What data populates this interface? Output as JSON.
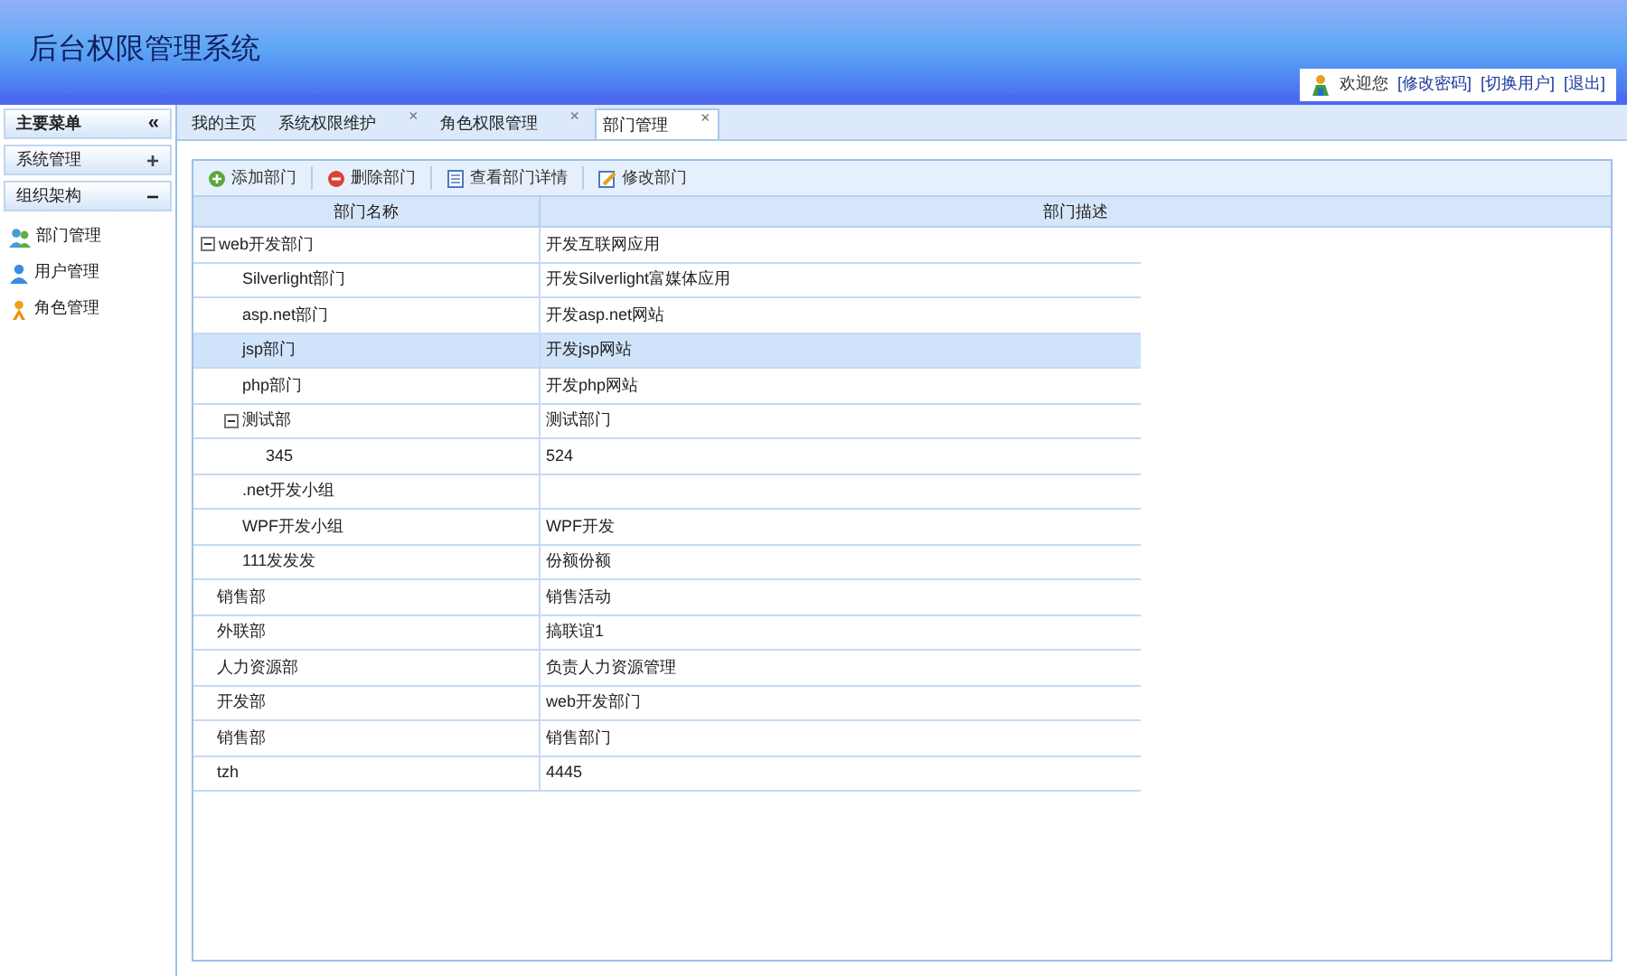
{
  "header": {
    "title": "后台权限管理系统",
    "welcome": "欢迎您",
    "links": [
      "[修改密码]",
      "[切换用户]",
      "[退出]"
    ]
  },
  "sidebar": {
    "title": "主要菜单",
    "collapse_glyph": "«",
    "sections": [
      {
        "label": "系统管理",
        "expanded": false,
        "toggle": "+"
      },
      {
        "label": "组织架构",
        "expanded": true,
        "toggle": "−"
      }
    ],
    "items": [
      {
        "label": "部门管理",
        "kind": "dept"
      },
      {
        "label": "用户管理",
        "kind": "user"
      },
      {
        "label": "角色管理",
        "kind": "role"
      }
    ]
  },
  "tabs": [
    {
      "label": "我的主页",
      "selected": false,
      "closable": false
    },
    {
      "label": "系统权限维护",
      "selected": false,
      "closable": true
    },
    {
      "label": "角色权限管理",
      "selected": false,
      "closable": true
    },
    {
      "label": "部门管理",
      "selected": true,
      "closable": true
    }
  ],
  "close_glyph": "×",
  "toolbar": [
    {
      "label": "添加部门",
      "kind": "add"
    },
    {
      "label": "删除部门",
      "kind": "delete"
    },
    {
      "label": "查看部门详情",
      "kind": "view"
    },
    {
      "label": "修改部门",
      "kind": "edit"
    }
  ],
  "table": {
    "columns": [
      "部门名称",
      "部门描述"
    ],
    "rows": [
      {
        "name": "web开发部门",
        "description": "开发互联网应用",
        "selected": false,
        "expanded": true,
        "children": [
          {
            "name": "Silverlight部门",
            "description": "开发Silverlight富媒体应用",
            "selected": false
          },
          {
            "name": "asp.net部门",
            "description": "开发asp.net网站",
            "selected": false
          },
          {
            "name": "jsp部门",
            "description": "开发jsp网站",
            "selected": true
          },
          {
            "name": "php部门",
            "description": "开发php网站",
            "selected": false
          },
          {
            "name": "测试部",
            "description": "测试部门",
            "selected": false,
            "expanded": true,
            "children": [
              {
                "name": "345",
                "description": "524",
                "selected": false
              }
            ]
          },
          {
            "name": ".net开发小组",
            "selected": false
          },
          {
            "name": "WPF开发小组",
            "description": "WPF开发",
            "selected": false
          },
          {
            "name": "111发发发",
            "description": "份额份额",
            "selected": false
          }
        ]
      },
      {
        "name": "销售部",
        "description": "销售活动",
        "selected": false
      },
      {
        "name": "外联部",
        "description": "搞联谊1",
        "selected": false
      },
      {
        "name": "人力资源部",
        "description": "负责人力资源管理",
        "selected": false
      },
      {
        "name": "开发部",
        "description": "web开发部门",
        "selected": false
      },
      {
        "name": "销售部",
        "description": "销售部门",
        "selected": false
      },
      {
        "name": "tzh",
        "description": "4445",
        "selected": false
      }
    ]
  }
}
